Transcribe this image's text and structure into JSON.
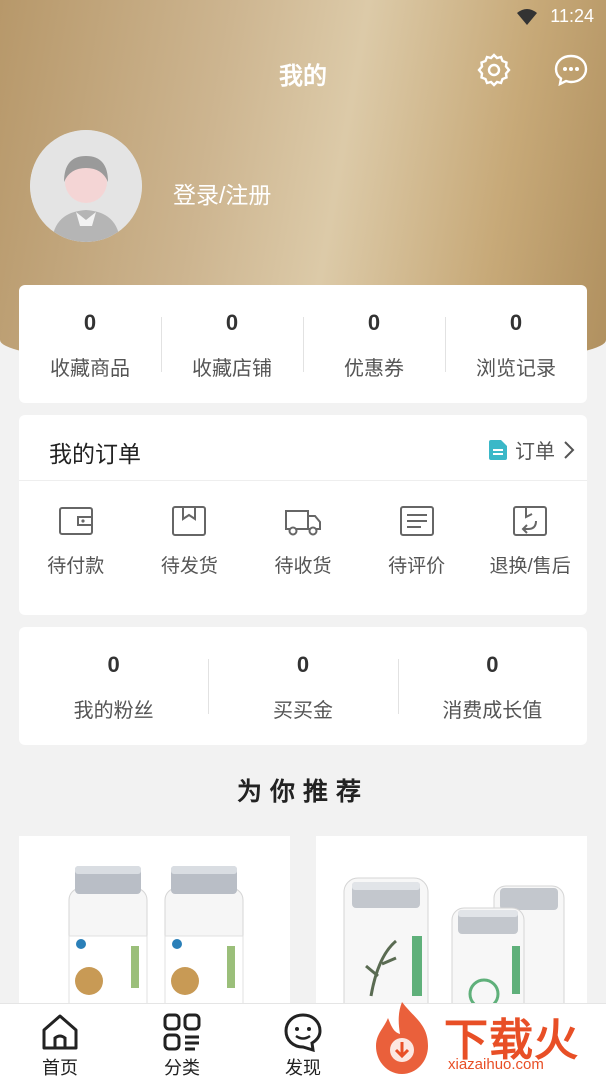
{
  "status_bar": {
    "time": "11:24"
  },
  "header": {
    "title": "我的"
  },
  "profile": {
    "login_text": "登录/注册"
  },
  "stats": [
    {
      "value": "0",
      "label": "收藏商品"
    },
    {
      "value": "0",
      "label": "收藏店铺"
    },
    {
      "value": "0",
      "label": "优惠券"
    },
    {
      "value": "0",
      "label": "浏览记录"
    }
  ],
  "orders": {
    "title": "我的订单",
    "link_label": "订单",
    "items": [
      {
        "label": "待付款",
        "icon": "wallet-icon"
      },
      {
        "label": "待发货",
        "icon": "box-icon"
      },
      {
        "label": "待收货",
        "icon": "truck-icon"
      },
      {
        "label": "待评价",
        "icon": "review-icon"
      },
      {
        "label": "退换/售后",
        "icon": "return-icon"
      }
    ]
  },
  "fans": [
    {
      "value": "0",
      "label": "我的粉丝"
    },
    {
      "value": "0",
      "label": "买买金"
    },
    {
      "value": "0",
      "label": "消费成长值"
    }
  ],
  "recommend": {
    "title": "为你推荐"
  },
  "tabbar": [
    {
      "label": "首页",
      "icon": "home-icon"
    },
    {
      "label": "分类",
      "icon": "category-icon"
    },
    {
      "label": "发现",
      "icon": "discover-icon"
    }
  ],
  "watermark": {
    "big": "下载火",
    "small": "xiazaihuo.com"
  },
  "colors": {
    "accent_gold": "#c9ad80",
    "watermark_orange": "#e84f26",
    "order_link_icon": "#3bb8c8"
  }
}
